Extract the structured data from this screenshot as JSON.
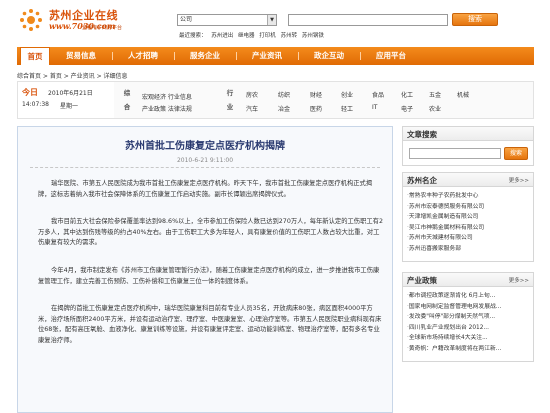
{
  "header": {
    "logo_title": "苏州企业在线",
    "logo_url": "www.7030.com",
    "logo_sub": "全程电子商务平台",
    "search_select": "公司",
    "search_button": "搜索",
    "hot_label": "最近搜索：",
    "hot_words": [
      "苏州进出",
      "继电器",
      "打印机",
      "苏州转",
      "苏州钢铁"
    ],
    "accent": "#e06a04"
  },
  "nav": {
    "items": [
      "首页",
      "贸易信息",
      "人才招聘",
      "服务企业",
      "产业资讯",
      "政企互动",
      "应用平台"
    ]
  },
  "breadcrumb": "综合首页 > 首页 > 产业资讯 > 详细信息",
  "infobar": {
    "today": "今日",
    "date": "2010年6月21日",
    "time": "14:07:38",
    "week": "星期一",
    "cat1_label": "综合",
    "cat1_links_row1": "宏观经济 行业信息",
    "cat1_links_row2": "产业政策 法律法规",
    "cat2_label": "行业",
    "industry_row1": [
      "房农",
      "纺织",
      "财经",
      "创业",
      "食品",
      "化工",
      "五金",
      "机械"
    ],
    "industry_row2": [
      "汽车",
      "冶金",
      "医药",
      "轻工",
      "IT",
      "电子",
      "农业"
    ]
  },
  "article": {
    "title": "苏州首批工伤康复定点医疗机构揭牌",
    "date": "2010-6-21 9:11:00",
    "paragraphs": [
      "瑞华医院、市第五人民医院成为我市首批工伤康复定点医疗机构。昨天下午，我市首批工伤康复定点医疗机构正式揭牌，这标志着纳入我市社会保障体系的工伤康复工作启动实施。副市长谭颖出席揭牌仪式。",
      "我市目前五大社会保险参保覆盖率达到98.6%以上，全市参加工伤保险人数已达到270万人，每年新认定的工伤职工有2万多人，其中达到伤残等级的约占40%左右。由于工伤职工大多为年轻人，具有康复价值的工伤职工人数占较大比重，对工伤康复有较大的需求。",
      "今年4月，我市制定发布《苏州市工伤康复管理暂行办法》，随着工伤康复定点医疗机构的成立，进一步推进我市工伤康复管理工作，建立完善工伤预防、工伤补偿和工伤康复三位一体的制度体系。",
      "在揭牌的首批工伤康复定点医疗机构中，瑞华医院康复科目前有专业人员35名，开放病床80张，病区面积4000平方米，治疗场所面积2400平方米，并设有运动治疗室、理疗室、中医康复室、心理治疗室等。市第五人民医院职业病科现有床位68张，配有高压氧舱、血液净化、康复训练等设施，并设有康复评定室、运动功能训练室、物理治疗室等，配有多名专业康复治疗师。"
    ]
  },
  "right": {
    "search_title": "文章搜索",
    "search_button": "搜索",
    "companies_title": "苏州名企",
    "more": "更多>>",
    "companies": [
      "常熟农丰种子农药批发中心",
      "苏州市宏泰德贸服务有限公司",
      "天津增凯金属制造有限公司",
      "吴江市神鹅金属材料有限公司",
      "苏州市天城建材有限公司",
      "苏州迅喜搬家服务部"
    ],
    "policy_title": "产业政策",
    "policies": [
      "都市调控政策逐渐肯化 6月上旬...",
      "国家电网制定监督管理电网发展战...",
      "发改委\"叫停\"部分煤制天然气项...",
      "四川乳业产业规划出台 2012...",
      "全球新市场持续增长4大关注...",
      "黄奇帆：户籍改革制度将在两江新..."
    ]
  }
}
